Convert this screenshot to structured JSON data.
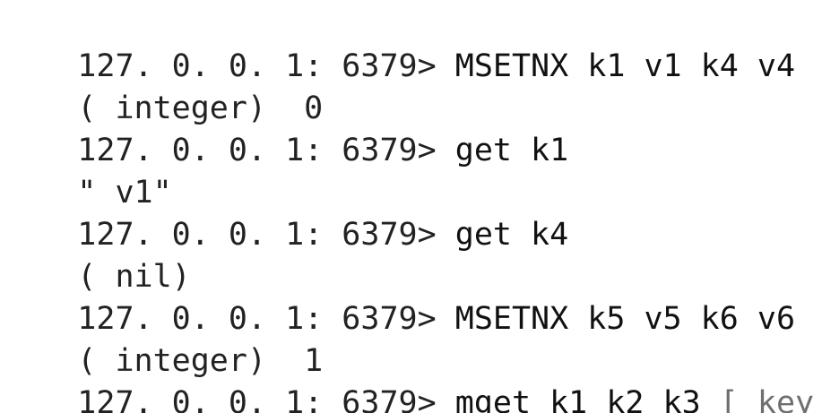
{
  "terminal": {
    "prompt": "127. 0. 0. 1: 6379>",
    "lines": [
      {
        "type": "command",
        "prompt": "127. 0. 0. 1: 6379>",
        "command": "MSETNX k1 v1 k4 v4"
      },
      {
        "type": "output",
        "text": "( integer)  0"
      },
      {
        "type": "command",
        "prompt": "127. 0. 0. 1: 6379>",
        "command": "get k1"
      },
      {
        "type": "output",
        "text": "\" v1\""
      },
      {
        "type": "command",
        "prompt": "127. 0. 0. 1: 6379>",
        "command": "get k4"
      },
      {
        "type": "output",
        "text": "( nil)"
      },
      {
        "type": "command",
        "prompt": "127. 0. 0. 1: 6379>",
        "command": "MSETNX k5 v5 k6 v6"
      },
      {
        "type": "output",
        "text": "( integer)  1"
      },
      {
        "type": "command",
        "prompt": "127. 0. 0. 1: 6379>",
        "command": "mget k1 k2 k3",
        "hint": "[ key ...]"
      }
    ]
  }
}
